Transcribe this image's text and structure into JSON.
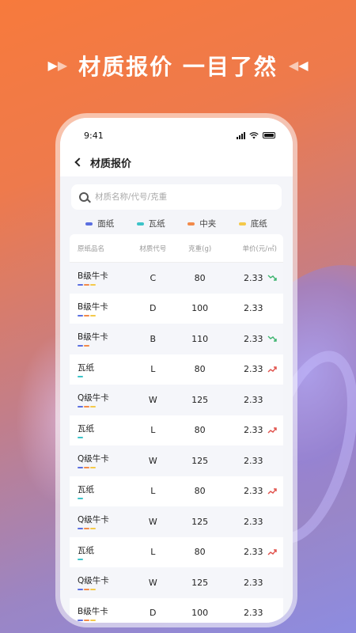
{
  "promo": {
    "title": "材质报价 一目了然"
  },
  "status": {
    "time": "9:41"
  },
  "nav": {
    "title": "材质报价"
  },
  "search": {
    "placeholder": "材质名称/代号/克重"
  },
  "legend": [
    {
      "label": "面纸",
      "color": "#5b6fe0"
    },
    {
      "label": "瓦纸",
      "color": "#3cc3c8"
    },
    {
      "label": "中夹",
      "color": "#f28a4a"
    },
    {
      "label": "底纸",
      "color": "#f4c94a"
    }
  ],
  "table": {
    "headers": [
      "原纸品名",
      "材质代号",
      "克重(g)",
      "单价(元/㎡)"
    ],
    "rows": [
      {
        "name": "B级牛卡",
        "code": "C",
        "weight": "80",
        "price": "2.33",
        "trend": "down",
        "bars": [
          "#5b6fe0",
          "#f28a4a",
          "#f4c94a"
        ]
      },
      {
        "name": "B级牛卡",
        "code": "D",
        "weight": "100",
        "price": "2.33",
        "trend": "",
        "bars": [
          "#5b6fe0",
          "#f28a4a",
          "#f4c94a"
        ]
      },
      {
        "name": "B级牛卡",
        "code": "B",
        "weight": "110",
        "price": "2.33",
        "trend": "down",
        "bars": [
          "#5b6fe0",
          "#f28a4a"
        ]
      },
      {
        "name": "瓦纸",
        "code": "L",
        "weight": "80",
        "price": "2.33",
        "trend": "up",
        "bars": [
          "#3cc3c8"
        ]
      },
      {
        "name": "Q级牛卡",
        "code": "W",
        "weight": "125",
        "price": "2.33",
        "trend": "",
        "bars": [
          "#5b6fe0",
          "#f28a4a",
          "#f4c94a"
        ]
      },
      {
        "name": "瓦纸",
        "code": "L",
        "weight": "80",
        "price": "2.33",
        "trend": "up",
        "bars": [
          "#3cc3c8"
        ]
      },
      {
        "name": "Q级牛卡",
        "code": "W",
        "weight": "125",
        "price": "2.33",
        "trend": "",
        "bars": [
          "#5b6fe0",
          "#f28a4a",
          "#f4c94a"
        ]
      },
      {
        "name": "瓦纸",
        "code": "L",
        "weight": "80",
        "price": "2.33",
        "trend": "up",
        "bars": [
          "#3cc3c8"
        ]
      },
      {
        "name": "Q级牛卡",
        "code": "W",
        "weight": "125",
        "price": "2.33",
        "trend": "",
        "bars": [
          "#5b6fe0",
          "#f28a4a",
          "#f4c94a"
        ]
      },
      {
        "name": "瓦纸",
        "code": "L",
        "weight": "80",
        "price": "2.33",
        "trend": "up",
        "bars": [
          "#3cc3c8"
        ]
      },
      {
        "name": "Q级牛卡",
        "code": "W",
        "weight": "125",
        "price": "2.33",
        "trend": "",
        "bars": [
          "#5b6fe0",
          "#f28a4a",
          "#f4c94a"
        ]
      },
      {
        "name": "B级牛卡",
        "code": "D",
        "weight": "100",
        "price": "2.33",
        "trend": "",
        "bars": [
          "#5b6fe0",
          "#f28a4a",
          "#f4c94a"
        ]
      }
    ]
  },
  "colors": {
    "trend_up": "#e0504a",
    "trend_down": "#3cb46e"
  }
}
